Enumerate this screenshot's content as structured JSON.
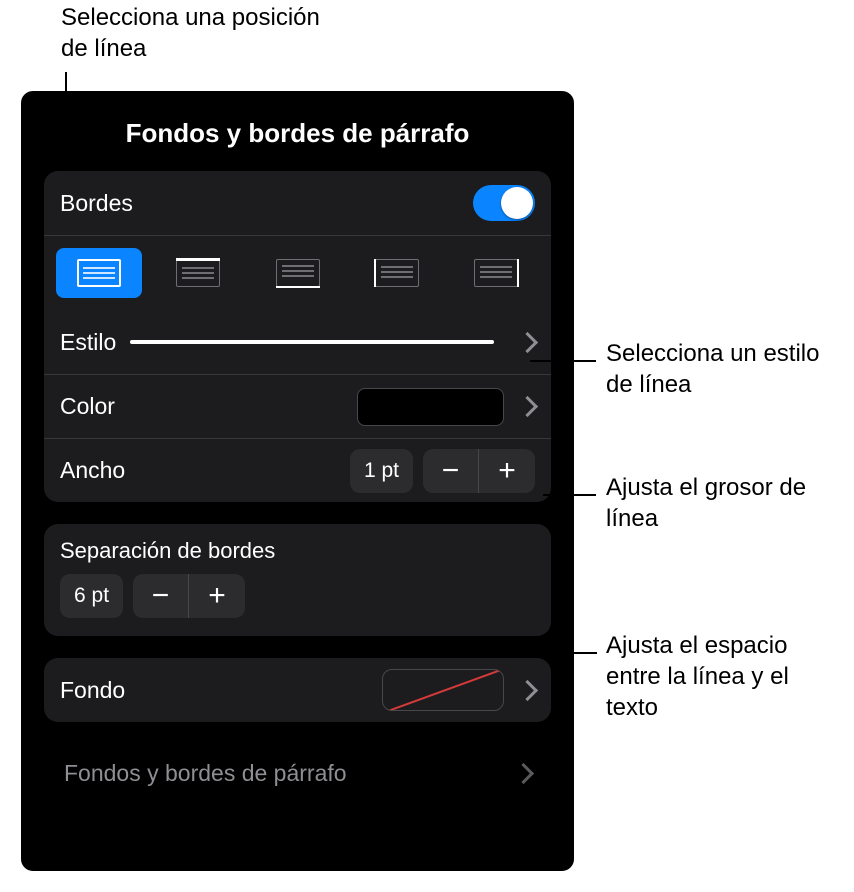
{
  "callouts": {
    "top": "Selecciona una posición de línea",
    "style": "Selecciona un estilo de línea",
    "width": "Ajusta el grosor de línea",
    "offset": "Ajusta el espacio entre la línea y el texto"
  },
  "panel": {
    "title": "Fondos y bordes de párrafo",
    "borders_label": "Bordes",
    "style_label": "Estilo",
    "color_label": "Color",
    "width_label": "Ancho",
    "width_value": "1 pt",
    "offset_heading": "Separación de bordes",
    "offset_value": "6 pt",
    "fill_label": "Fondo",
    "nav_back": "Fondos y bordes de párrafo"
  },
  "colors": {
    "selected_swatch": "#000000",
    "accent": "#0a84ff"
  }
}
